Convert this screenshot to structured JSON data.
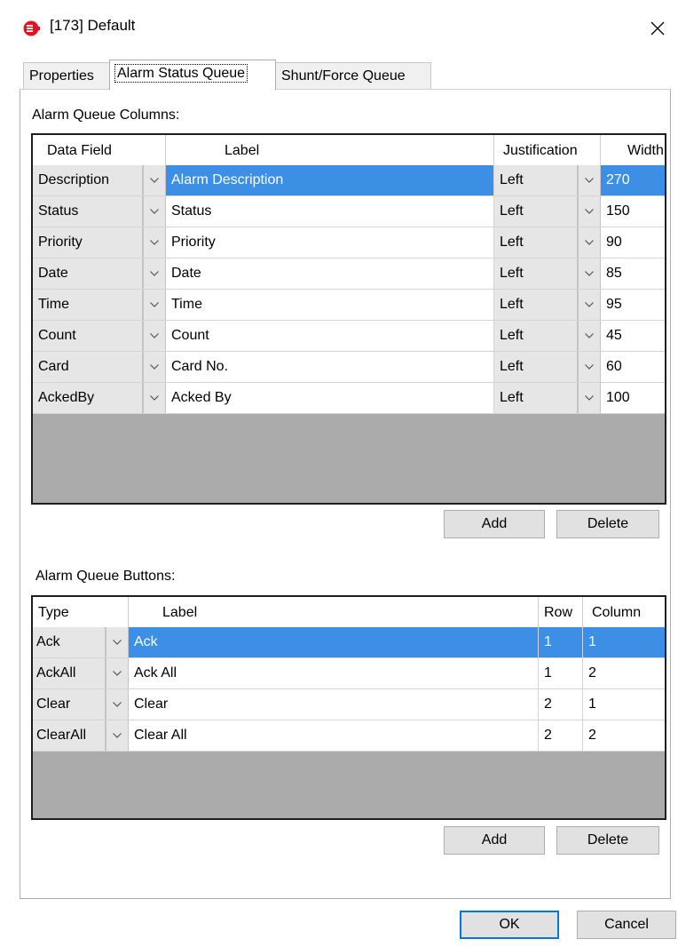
{
  "window": {
    "title": "[173] Default"
  },
  "tabs": [
    {
      "label": "Properties"
    },
    {
      "label": "Alarm Status Queue"
    },
    {
      "label": "Shunt/Force Queue"
    }
  ],
  "columns_section": {
    "label": "Alarm Queue Columns:",
    "headers": {
      "data_field": "Data Field",
      "label": "Label",
      "justification": "Justification",
      "width": "Width"
    },
    "rows": [
      {
        "data_field": "Description",
        "label": "Alarm Description",
        "justification": "Left",
        "width": "270"
      },
      {
        "data_field": "Status",
        "label": "Status",
        "justification": "Left",
        "width": "150"
      },
      {
        "data_field": "Priority",
        "label": "Priority",
        "justification": "Left",
        "width": "90"
      },
      {
        "data_field": "Date",
        "label": "Date",
        "justification": "Left",
        "width": "85"
      },
      {
        "data_field": "Time",
        "label": "Time",
        "justification": "Left",
        "width": "95"
      },
      {
        "data_field": "Count",
        "label": "Count",
        "justification": "Left",
        "width": "45"
      },
      {
        "data_field": "Card",
        "label": "Card No.",
        "justification": "Left",
        "width": "60"
      },
      {
        "data_field": "AckedBy",
        "label": "Acked By",
        "justification": "Left",
        "width": "100"
      }
    ],
    "add_label": "Add",
    "delete_label": "Delete"
  },
  "buttons_section": {
    "label": "Alarm Queue Buttons:",
    "headers": {
      "type": "Type",
      "label": "Label",
      "row": "Row",
      "column": "Column"
    },
    "rows": [
      {
        "type": "Ack",
        "label": "Ack",
        "row": "1",
        "column": "1"
      },
      {
        "type": "AckAll",
        "label": "Ack All",
        "row": "1",
        "column": "2"
      },
      {
        "type": "Clear",
        "label": "Clear",
        "row": "2",
        "column": "1"
      },
      {
        "type": "ClearAll",
        "label": "Clear All",
        "row": "2",
        "column": "2"
      }
    ],
    "add_label": "Add",
    "delete_label": "Delete"
  },
  "footer": {
    "ok_label": "OK",
    "cancel_label": "Cancel"
  },
  "colors": {
    "selection": "#3d8fe6",
    "grid_empty": "#ababab",
    "app_icon": "#e81123",
    "default_button_border": "#0078d7"
  },
  "icons": {
    "app": "alarm-stop-icon",
    "close": "close-icon",
    "dropdown": "chevron-down-icon"
  }
}
